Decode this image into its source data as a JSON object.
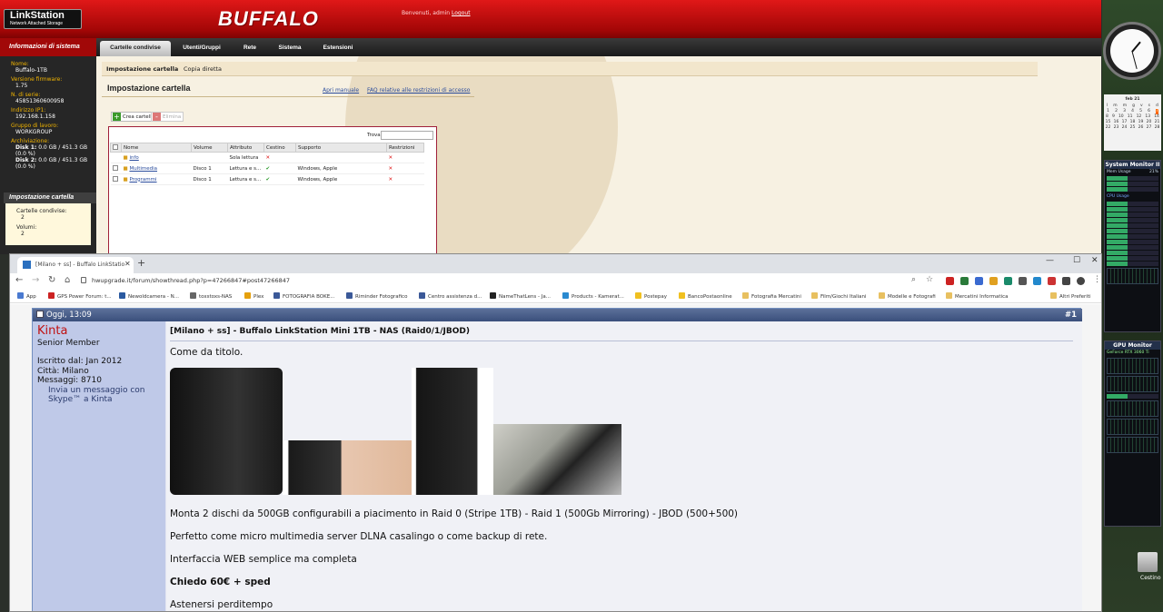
{
  "nas": {
    "brand_logo_line1": "LinkStation",
    "brand_logo_line2": "Network Attached Storage",
    "buffalo_logo": "BUFFALO",
    "welcome": "Benvenuti, admin",
    "logout": "Logout",
    "sidebar_heading": "Informazioni di sistema",
    "nav_tabs": [
      "Cartelle condivise",
      "Utenti/Gruppi",
      "Rete",
      "Sistema",
      "Estensioni"
    ],
    "info": [
      {
        "label": "Nome:",
        "value": "Buffalo-1TB"
      },
      {
        "label": "Versione firmware:",
        "value": "1.75"
      },
      {
        "label": "N. di serie:",
        "value": "45851360600958"
      },
      {
        "label": "Indirizzo IP1:",
        "value": "192.168.1.158"
      },
      {
        "label": "Gruppo di lavoro:",
        "value": "WORKGROUP"
      }
    ],
    "storage_label": "Archiviazione:",
    "disk1_label": "Disk 1:",
    "disk1_value": "0.0 GB / 451.3 GB (0.0 %)",
    "disk2_label": "Disk 2:",
    "disk2_value": "0.0 GB / 451.3 GB (0.0 %)",
    "side_section": "Impostazione cartella",
    "shared_label": "Cartelle condivise:",
    "shared_value": "2",
    "volumes_label": "Volumi:",
    "volumes_value": "2",
    "subnav": [
      "Impostazione cartella",
      "Copia diretta"
    ],
    "page_title": "Impostazione cartella",
    "link_manual": "Apri manuale",
    "link_faq": "FAQ relative alle restrizioni di accesso",
    "btn_create": "Crea cartella",
    "btn_delete": "Elimina",
    "find_label": "Trova",
    "columns": [
      "Nome",
      "Volume",
      "Attributo",
      "Cestino",
      "Supporto",
      "Restrizioni"
    ],
    "rows": [
      {
        "name": "info",
        "volume": "",
        "attr": "Sola lettura",
        "trash": "✕",
        "support": "",
        "restrict": "✕"
      },
      {
        "name": "Multimedia",
        "volume": "Disco 1",
        "attr": "Lettura e s...",
        "trash": "✔",
        "support": "Windows, Apple",
        "restrict": "✕"
      },
      {
        "name": "Programmi",
        "volume": "Disco 1",
        "attr": "Lettura e s...",
        "trash": "✔",
        "support": "Windows, Apple",
        "restrict": "✕"
      }
    ]
  },
  "browser": {
    "tab_title": "[Milano + ss] - Buffalo LinkStatio",
    "url": "hwupgrade.it/forum/showthread.php?p=47266847#post47266847",
    "bookmarks": [
      "App",
      "GPS Power Forum: t...",
      "Newoldcamera - N...",
      "toxstoxs-NAS",
      "Plex",
      "FOTOGRAFIA BOKE...",
      "Riminder Fotografico",
      "Centro assistenza d...",
      "NameThatLens - Ja...",
      "Products - Kamerat...",
      "Postepay",
      "BancoPostaonline",
      "Fotografia Mercatini",
      "Film/Giochi Italiani",
      "Modelle e Fotografi",
      "Mercatini Informatica",
      "Altri Preferiti"
    ]
  },
  "post": {
    "date": "Oggi, 13:09",
    "number": "#1",
    "username": "Kinta",
    "role": "Senior Member",
    "joined": "Iscritto dal: Jan 2012",
    "city": "Città: Milano",
    "messages": "Messaggi: 8710",
    "skype": "Invia un messaggio con Skype™ a Kinta",
    "title": "[Milano + ss] - Buffalo LinkStation Mini 1TB - NAS (Raid0/1/JBOD)",
    "line1": "Come da titolo.",
    "line2": "Monta 2 dischi da 500GB configurabili a piacimento in Raid 0 (Stripe 1TB) - Raid 1 (500Gb Mirroring) - JBOD (500+500)",
    "line3": "Perfetto come micro multimedia server DLNA casalingo o come backup di rete.",
    "line4": "Interfaccia WEB semplice ma completa",
    "line5": "Chiedo 60€ + sped",
    "line6": "Astenersi perditempo"
  },
  "desktop": {
    "cal_month": "feb 21",
    "sysmon_title": "System Monitor II",
    "mem_label": "Mem Usage",
    "mem_value": "21%",
    "cpu_label": "CPU Usage",
    "gpu_title": "GPU Monitor",
    "gpu_name": "GeForce RTX 3060 Ti",
    "trash_label": "Cestino"
  }
}
